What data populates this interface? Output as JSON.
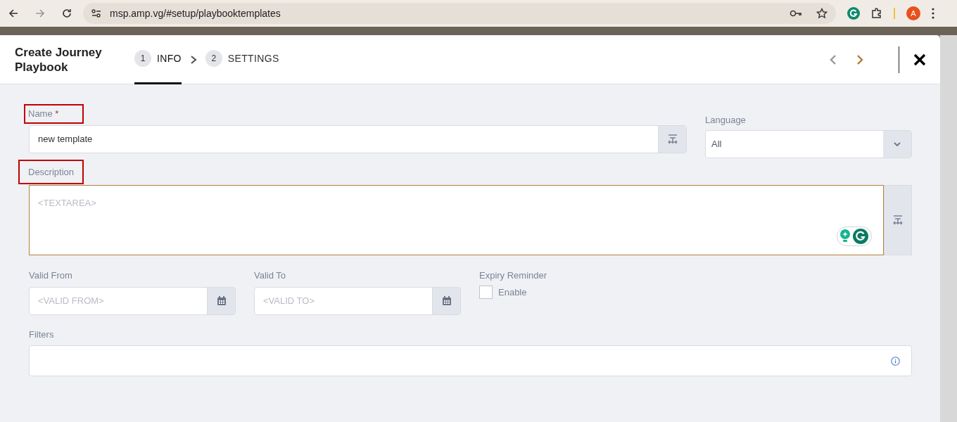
{
  "browser": {
    "url": "msp.amp.vg/#setup/playbooktemplates",
    "profile_initial": "A"
  },
  "modal": {
    "title": "Create Journey Playbook",
    "steps": [
      {
        "number": "1",
        "label": "INFO",
        "selected": true
      },
      {
        "number": "2",
        "label": "SETTINGS",
        "selected": false
      }
    ]
  },
  "form": {
    "name": {
      "label": "Name",
      "required_mark": "*",
      "value": "new template",
      "highlighted": true
    },
    "language": {
      "label": "Language",
      "value": "All"
    },
    "description": {
      "label": "Description",
      "placeholder": "<TEXTAREA>",
      "highlighted": true
    },
    "valid_from": {
      "label": "Valid From",
      "placeholder": "<VALID FROM>"
    },
    "valid_to": {
      "label": "Valid To",
      "placeholder": "<VALID TO>"
    },
    "expiry_reminder": {
      "label": "Expiry Reminder",
      "option": "Enable",
      "checked": false
    },
    "filters": {
      "label": "Filters"
    }
  }
}
